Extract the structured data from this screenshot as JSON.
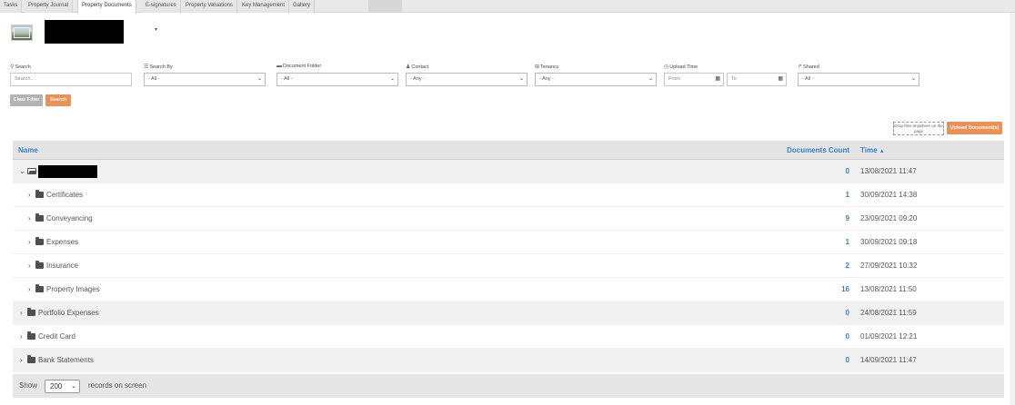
{
  "tabs": [
    {
      "label": "Tasks",
      "active": false
    },
    {
      "label": "Property Journal",
      "active": false
    },
    {
      "label": "Property Documents",
      "active": true
    },
    {
      "label": "E-signatures",
      "active": false
    },
    {
      "label": "Property Valuations",
      "active": false
    },
    {
      "label": "Key Management",
      "active": false
    },
    {
      "label": "Gallery",
      "active": false
    }
  ],
  "filters": {
    "search": {
      "label": "Search",
      "placeholder": "Search..."
    },
    "search_by": {
      "label": "Search By",
      "value": "- All -"
    },
    "document_folder": {
      "label": "Document Folder",
      "value": "- All -"
    },
    "contact": {
      "label": "Contact",
      "value": "- Any -"
    },
    "tenancy": {
      "label": "Tenancy",
      "value": "- Any -"
    },
    "upload_time": {
      "label": "Upload Time",
      "from_placeholder": "From",
      "to_placeholder": "To"
    },
    "shared": {
      "label": "Shared",
      "value": "- All -"
    },
    "clear_label": "Clear Filter",
    "search_label": "Search"
  },
  "upload": {
    "dropzone_text": "Drop files anywhere on the page",
    "button_label": "Upload Document(s)"
  },
  "table": {
    "headers": {
      "name": "Name",
      "count": "Documents Count",
      "time": "Time"
    },
    "rows": [
      {
        "name": "",
        "count": "0",
        "time": "13/08/2021 11:47"
      },
      {
        "name": "Certificates",
        "count": "1",
        "time": "30/09/2021 14:38"
      },
      {
        "name": "Conveyancing",
        "count": "9",
        "time": "23/09/2021 09:20"
      },
      {
        "name": "Expenses",
        "count": "1",
        "time": "30/09/2021 09:18"
      },
      {
        "name": "Insurance",
        "count": "2",
        "time": "27/09/2021 10:32"
      },
      {
        "name": "Property Images",
        "count": "16",
        "time": "13/08/2021 11:50"
      },
      {
        "name": "Portfolio Expenses",
        "count": "0",
        "time": "24/08/2021 11:59"
      },
      {
        "name": "Credit Card",
        "count": "0",
        "time": "01/09/2021 12:21"
      },
      {
        "name": "Bank Statements",
        "count": "0",
        "time": "14/09/2021 11:47"
      }
    ]
  },
  "footer": {
    "show_label": "Show",
    "page_size": "200",
    "records_label": "records on screen"
  },
  "colors": {
    "accent_blue": "#3a82c4",
    "button_orange": "#ee8f55",
    "button_grey": "#b3b3b3"
  }
}
